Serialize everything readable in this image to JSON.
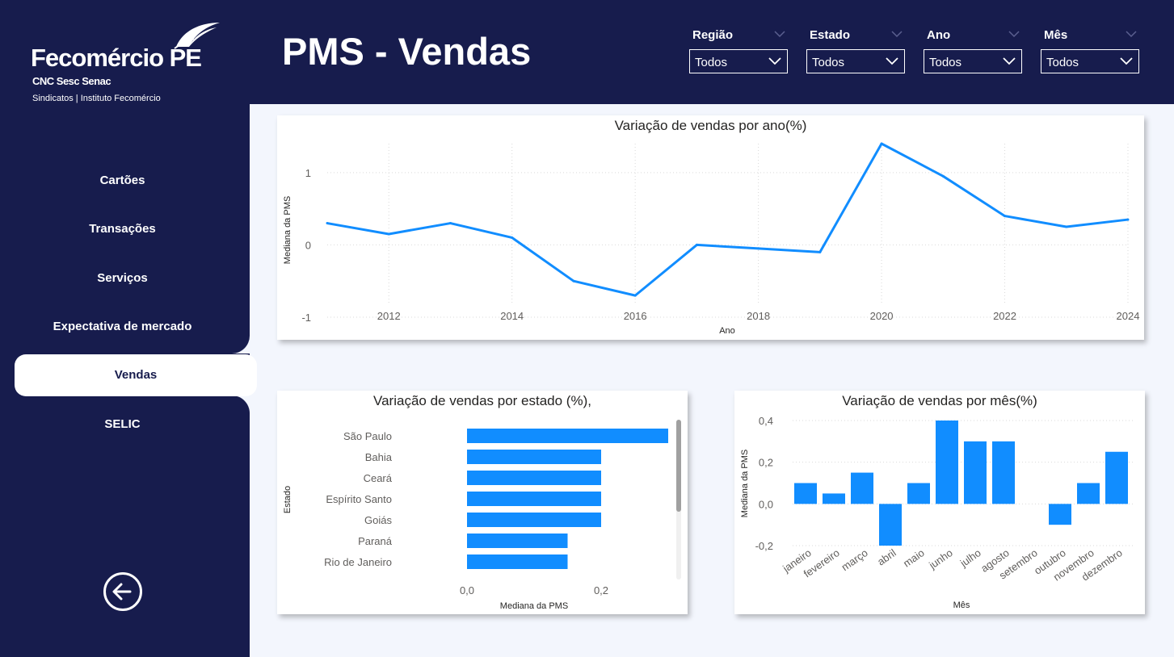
{
  "brand": {
    "logo_text": "Fecomércio PE",
    "logo_sub": "CNC Sesc Senac",
    "logo_sub2": "Sindicatos  |  Instituto Fecomércio"
  },
  "page_title": "PMS - Vendas",
  "nav": {
    "items": [
      {
        "label": "Cartões",
        "active": false
      },
      {
        "label": "Transações",
        "active": false
      },
      {
        "label": "Serviços",
        "active": false
      },
      {
        "label": "Expectativa de mercado",
        "active": false
      },
      {
        "label": "Vendas",
        "active": true
      },
      {
        "label": "SELIC",
        "active": false
      }
    ],
    "back_icon": "arrow-left-circle-icon"
  },
  "filters": [
    {
      "label": "Região",
      "value": "Todos"
    },
    {
      "label": "Estado",
      "value": "Todos"
    },
    {
      "label": "Ano",
      "value": "Todos"
    },
    {
      "label": "Mês",
      "value": "Todos"
    }
  ],
  "colors": {
    "navy": "#171c4d",
    "series": "#118dff",
    "background": "#f3f6fd"
  },
  "chart_data": [
    {
      "type": "line",
      "title": "Variação de vendas por ano(%)",
      "xlabel": "Ano",
      "ylabel": "Mediana da PMS",
      "x": [
        2011,
        2012,
        2013,
        2014,
        2015,
        2016,
        2017,
        2018,
        2019,
        2020,
        2021,
        2022,
        2023,
        2024
      ],
      "values": [
        0.3,
        0.15,
        0.3,
        0.1,
        -0.5,
        -0.7,
        0.0,
        -0.05,
        -0.1,
        1.4,
        0.95,
        0.4,
        0.25,
        0.35
      ],
      "xticks": [
        2012,
        2014,
        2016,
        2018,
        2020,
        2022,
        2024
      ],
      "yticks": [
        1,
        0,
        -1
      ],
      "ylim": [
        -1,
        1.4
      ],
      "grid": true
    },
    {
      "type": "bar",
      "orientation": "horizontal",
      "title": "Variação de vendas por estado (%),",
      "xlabel": "Mediana da PMS",
      "ylabel": "Estado",
      "categories": [
        "São Paulo",
        "Bahia",
        "Ceará",
        "Espírito Santo",
        "Goiás",
        "Paraná",
        "Rio de Janeiro"
      ],
      "values": [
        0.3,
        0.2,
        0.2,
        0.2,
        0.2,
        0.15,
        0.15
      ],
      "xticks": [
        "0,0",
        "0,2"
      ],
      "xlim": [
        0,
        0.3
      ]
    },
    {
      "type": "bar",
      "title": "Variação de vendas por mês(%)",
      "xlabel": "Mês",
      "ylabel": "Mediana da PMS",
      "categories": [
        "janeiro",
        "fevereiro",
        "março",
        "abril",
        "maio",
        "junho",
        "julho",
        "agosto",
        "setembro",
        "outubro",
        "novembro",
        "dezembro"
      ],
      "values": [
        0.1,
        0.05,
        0.15,
        -0.2,
        0.1,
        0.4,
        0.3,
        0.3,
        0.0,
        -0.1,
        0.1,
        0.25
      ],
      "yticks": [
        "0,4",
        "0,2",
        "0,0",
        "-0,2"
      ],
      "ylim": [
        -0.2,
        0.4
      ],
      "grid": true
    }
  ]
}
